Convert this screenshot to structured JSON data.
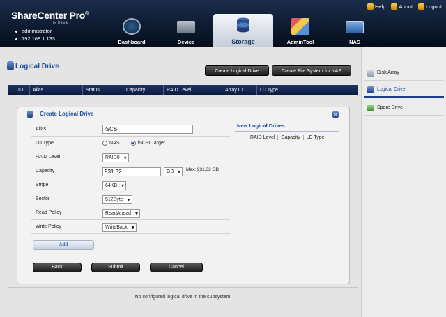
{
  "header": {
    "brand": "ShareCenter Pro",
    "brand_tm": "®",
    "brand_sub": "by D-Link",
    "user": "administrator",
    "ip": "192.168.1.133",
    "links": [
      "Help",
      "About",
      "Logout"
    ]
  },
  "nav": {
    "tabs": [
      "Dashboard",
      "Device",
      "Storage",
      "AdminTool",
      "NAS"
    ],
    "active": "Storage"
  },
  "page": {
    "title": "Logical Drive",
    "buttons": [
      "Create Logical Drive",
      "Create File System for NAS"
    ],
    "columns": [
      "ID",
      "Alias",
      "Status",
      "Capacity",
      "RAID Level",
      "Array ID",
      "LD Type"
    ],
    "empty_message": "No configured logical drive in the subsystem."
  },
  "dialog": {
    "title": "Create Logical Drive",
    "close": "x",
    "fields": {
      "alias_label": "Alias",
      "alias_value": "iSCSI",
      "ld_type_label": "LD Type",
      "ld_type_options": [
        "NAS",
        "iSCSI Target"
      ],
      "ld_type_selected": "iSCSI Target",
      "raid_label": "RAID Level",
      "raid_value": "RAID0",
      "capacity_label": "Capacity",
      "capacity_value": "931.32",
      "capacity_unit": "GB",
      "capacity_max": "Max: 931.32 GB",
      "stripe_label": "Stripe",
      "stripe_value": "64KB",
      "sector_label": "Sector",
      "sector_value": "512Byte",
      "read_label": "Read Policy",
      "read_value": "ReadAhead",
      "write_label": "Write Policy",
      "write_value": "WriteBack"
    },
    "add_label": "Add",
    "actions": [
      "Back",
      "Submit",
      "Cancel"
    ],
    "new_drives": {
      "title": "New Logical Drives",
      "columns": [
        "RAID Level",
        "Capacity",
        "LD Type"
      ]
    }
  },
  "sidebar": {
    "items": [
      "Disk Array",
      "Logical Drive",
      "Spare Drive"
    ],
    "active": "Logical Drive"
  }
}
